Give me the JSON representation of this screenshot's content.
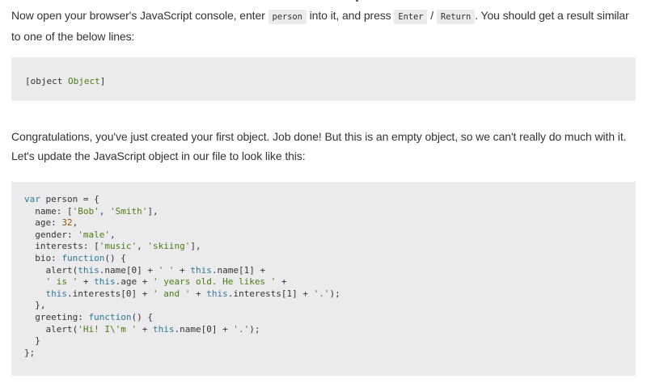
{
  "paragraph_1": {
    "part_a": "Now open your browser's JavaScript console, enter ",
    "code_person": "person",
    "part_b": " into it, and press ",
    "code_enter": "Enter",
    "slash": " / ",
    "code_return": "Return",
    "part_c": ". You should get a result similar to one of the below lines:"
  },
  "result_block": {
    "prefix": "[object ",
    "object_word": "Object",
    "suffix": "]"
  },
  "paragraph_2": {
    "line_1": "Congratulations, you've just created your first object. Job done! But this is an empty object, so we can't really do much with it.",
    "line_2": "Let's update the JavaScript object in our file to look like this:"
  },
  "code_block": {
    "lines": [
      [
        [
          "kw",
          "var"
        ],
        [
          "plain",
          " person = {"
        ]
      ],
      [
        [
          "plain",
          "  name: ["
        ],
        [
          "str",
          "'Bob'"
        ],
        [
          "plain",
          ", "
        ],
        [
          "str",
          "'Smith'"
        ],
        [
          "plain",
          "],"
        ]
      ],
      [
        [
          "plain",
          "  age: "
        ],
        [
          "num",
          "32"
        ],
        [
          "plain",
          ","
        ]
      ],
      [
        [
          "plain",
          "  gender: "
        ],
        [
          "str",
          "'male'"
        ],
        [
          "plain",
          ","
        ]
      ],
      [
        [
          "plain",
          "  interests: ["
        ],
        [
          "str",
          "'music'"
        ],
        [
          "plain",
          ", "
        ],
        [
          "str",
          "'skiing'"
        ],
        [
          "plain",
          "],"
        ]
      ],
      [
        [
          "plain",
          "  bio: "
        ],
        [
          "kw",
          "function"
        ],
        [
          "plain",
          "() {"
        ]
      ],
      [
        [
          "plain",
          "    alert("
        ],
        [
          "this",
          "this"
        ],
        [
          "plain",
          ".name[0] + "
        ],
        [
          "str",
          "' '"
        ],
        [
          "plain",
          " + "
        ],
        [
          "this",
          "this"
        ],
        [
          "plain",
          ".name[1] +"
        ]
      ],
      [
        [
          "plain",
          "    "
        ],
        [
          "str",
          "' is '"
        ],
        [
          "plain",
          " + "
        ],
        [
          "this",
          "this"
        ],
        [
          "plain",
          ".age + "
        ],
        [
          "str",
          "' years old. He likes '"
        ],
        [
          "plain",
          " +"
        ]
      ],
      [
        [
          "plain",
          "    "
        ],
        [
          "this",
          "this"
        ],
        [
          "plain",
          ".interests[0] + "
        ],
        [
          "str",
          "' and '"
        ],
        [
          "plain",
          " + "
        ],
        [
          "this",
          "this"
        ],
        [
          "plain",
          ".interests[1] + "
        ],
        [
          "str",
          "'.'"
        ],
        [
          "plain",
          ");"
        ]
      ],
      [
        [
          "plain",
          "  },"
        ]
      ],
      [
        [
          "plain",
          "  greeting: "
        ],
        [
          "kw",
          "function"
        ],
        [
          "plain",
          "() {"
        ]
      ],
      [
        [
          "plain",
          "    alert("
        ],
        [
          "str",
          "'Hi! I\\'m '"
        ],
        [
          "plain",
          " + "
        ],
        [
          "this",
          "this"
        ],
        [
          "plain",
          ".name[0] + "
        ],
        [
          "str",
          "'.'"
        ],
        [
          "plain",
          ");"
        ]
      ],
      [
        [
          "plain",
          "  }"
        ]
      ],
      [
        [
          "plain",
          "};"
        ]
      ]
    ]
  },
  "colors": {
    "text": "#333333",
    "code_background": "#ebebed",
    "keyword": "#2d7a96",
    "string": "#4b7c14",
    "number": "#8a5a00"
  }
}
